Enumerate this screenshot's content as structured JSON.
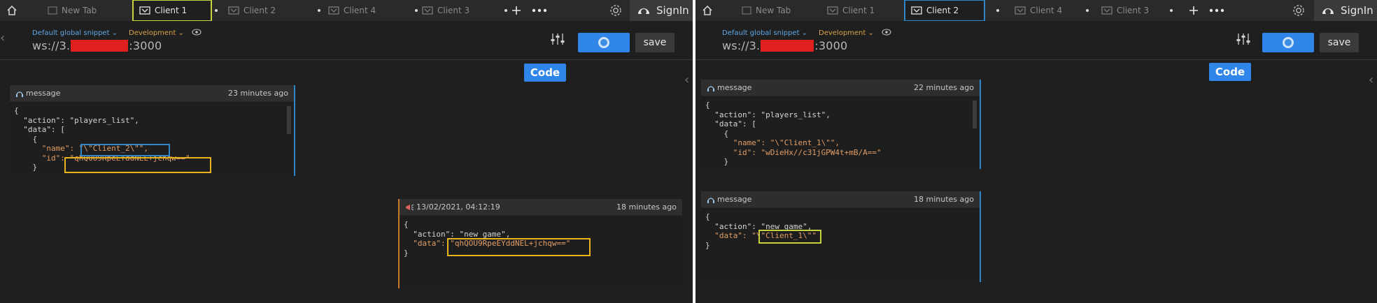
{
  "left": {
    "tabs": [
      {
        "label": "New Tab",
        "active": false
      },
      {
        "label": "Client 1",
        "active": true
      },
      {
        "label": "Client 2",
        "active": false
      },
      {
        "label": "Client 4",
        "active": false
      },
      {
        "label": "Client 3",
        "active": false
      }
    ],
    "signin": "SignIn",
    "snippet": "Default global snippet",
    "environment": "Development",
    "url_prefix": "ws://3.",
    "url_suffix": ":3000",
    "save": "save",
    "code": "Code",
    "messages": [
      {
        "title": "message",
        "time": "23 minutes ago",
        "lines": [
          "{",
          "  \"action\": \"players_list\",",
          "  \"data\": [",
          "    {",
          "      \"name\": \"\\\"Client_2\\\"\",",
          "      \"id\": \"qhQOU9RpeEYddNEL+jchqw==\"",
          "    }"
        ]
      },
      {
        "title": "13/02/2021, 04:12:19",
        "time": "18 minutes ago",
        "lines": [
          "{",
          "  \"action\": \"new_game\",",
          "  \"data\": \"qhQOU9RpeEYddNEL+jchqw==\"",
          "}"
        ]
      }
    ]
  },
  "right": {
    "tabs": [
      {
        "label": "New Tab",
        "active": false
      },
      {
        "label": "Client 1",
        "active": false
      },
      {
        "label": "Client 2",
        "active": true
      },
      {
        "label": "Client 4",
        "active": false
      },
      {
        "label": "Client 3",
        "active": false
      }
    ],
    "signin": "SignIn",
    "snippet": "Default global snippet",
    "environment": "Development",
    "url_prefix": "ws://3.",
    "url_suffix": ":3000",
    "save": "save",
    "code": "Code",
    "messages": [
      {
        "title": "message",
        "time": "22 minutes ago",
        "lines": [
          "{",
          "  \"action\": \"players_list\",",
          "  \"data\": [",
          "    {",
          "      \"name\": \"\\\"Client_1\\\"\",",
          "      \"id\": \"wDieHx//c31jGPW4t+mB/A==\"",
          "    }"
        ]
      },
      {
        "title": "message",
        "time": "18 minutes ago",
        "lines": [
          "{",
          "  \"action\": \"new_game\",",
          "  \"data\": \"\\\"Client_1\\\"\"",
          "}"
        ]
      }
    ]
  },
  "colors": {
    "accent_blue": "#2f86e8",
    "highlight_yellow": "#e8b31c",
    "highlight_green": "#c7d33e",
    "highlight_blue": "#2f86c8",
    "string_orange": "#e09d66",
    "redaction_red": "#e01f1f"
  }
}
